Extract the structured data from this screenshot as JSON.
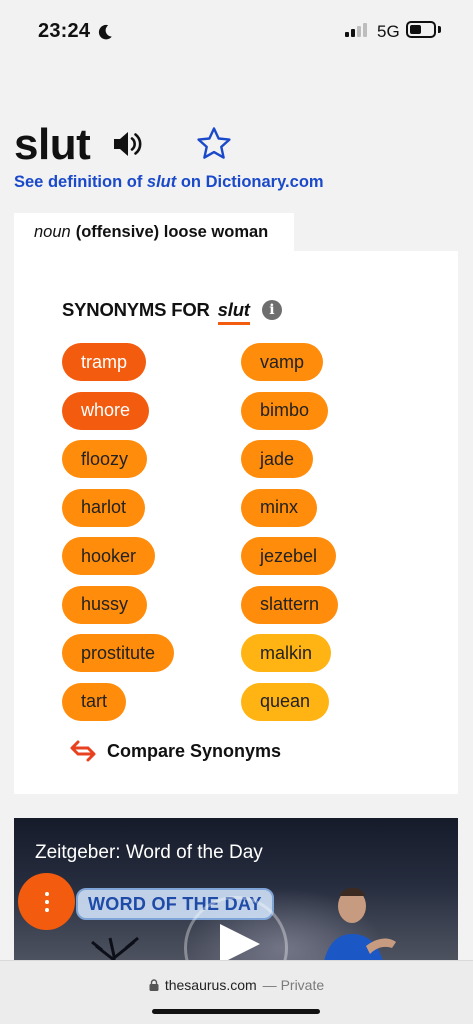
{
  "status_bar": {
    "time": "23:24",
    "network": "5G",
    "moon_icon": "moon-icon",
    "signal_bars_active": 2,
    "signal_bars_total": 4
  },
  "entry": {
    "headword": "slut",
    "speaker_icon": "speaker-icon",
    "favorite_icon": "star-outline-icon",
    "definition_link": {
      "prefix": "See definition of ",
      "word": "slut",
      "suffix": " on Dictionary.com"
    }
  },
  "sense": {
    "part_of_speech": "noun",
    "definition": "(offensive) loose woman"
  },
  "synonyms": {
    "heading": "SYNONYMS FOR",
    "word": "slut",
    "info_icon": "info-icon",
    "info_glyph": "i",
    "left_column": [
      {
        "label": "tramp",
        "color": "#f35b0f",
        "text": "light"
      },
      {
        "label": "whore",
        "color": "#f35b0f",
        "text": "light"
      },
      {
        "label": "floozy",
        "color": "#ff8c0b",
        "text": "dark"
      },
      {
        "label": "harlot",
        "color": "#ff8c0b",
        "text": "dark"
      },
      {
        "label": "hooker",
        "color": "#ff8c0b",
        "text": "dark"
      },
      {
        "label": "hussy",
        "color": "#ff8c0b",
        "text": "dark"
      },
      {
        "label": "prostitute",
        "color": "#ff8c0b",
        "text": "dark"
      },
      {
        "label": "tart",
        "color": "#ff8c0b",
        "text": "dark"
      }
    ],
    "right_column": [
      {
        "label": "vamp",
        "color": "#ff8c0b",
        "text": "dark"
      },
      {
        "label": "bimbo",
        "color": "#ff8c0b",
        "text": "dark"
      },
      {
        "label": "jade",
        "color": "#ff8c0b",
        "text": "dark"
      },
      {
        "label": "minx",
        "color": "#ff8c0b",
        "text": "dark"
      },
      {
        "label": "jezebel",
        "color": "#ff8c0b",
        "text": "dark"
      },
      {
        "label": "slattern",
        "color": "#ff8c0b",
        "text": "dark"
      },
      {
        "label": "malkin",
        "color": "#ffb413",
        "text": "dark"
      },
      {
        "label": "quean",
        "color": "#ffb413",
        "text": "dark"
      }
    ],
    "compare_label": "Compare Synonyms",
    "compare_icon": "swap-arrows-icon"
  },
  "video": {
    "title": "Zeitgeber: Word of the Day",
    "badge": "WORD OF THE DAY",
    "play_icon": "play-icon",
    "menu_icon": "vertical-dots-icon"
  },
  "browser": {
    "domain": "thesaurus.com",
    "separator": " — ",
    "mode": "Private",
    "lock_icon": "lock-icon"
  },
  "colors": {
    "brand_orange": "#f35b0f",
    "link_blue": "#1a49c9",
    "star_blue": "#1a49c9"
  }
}
